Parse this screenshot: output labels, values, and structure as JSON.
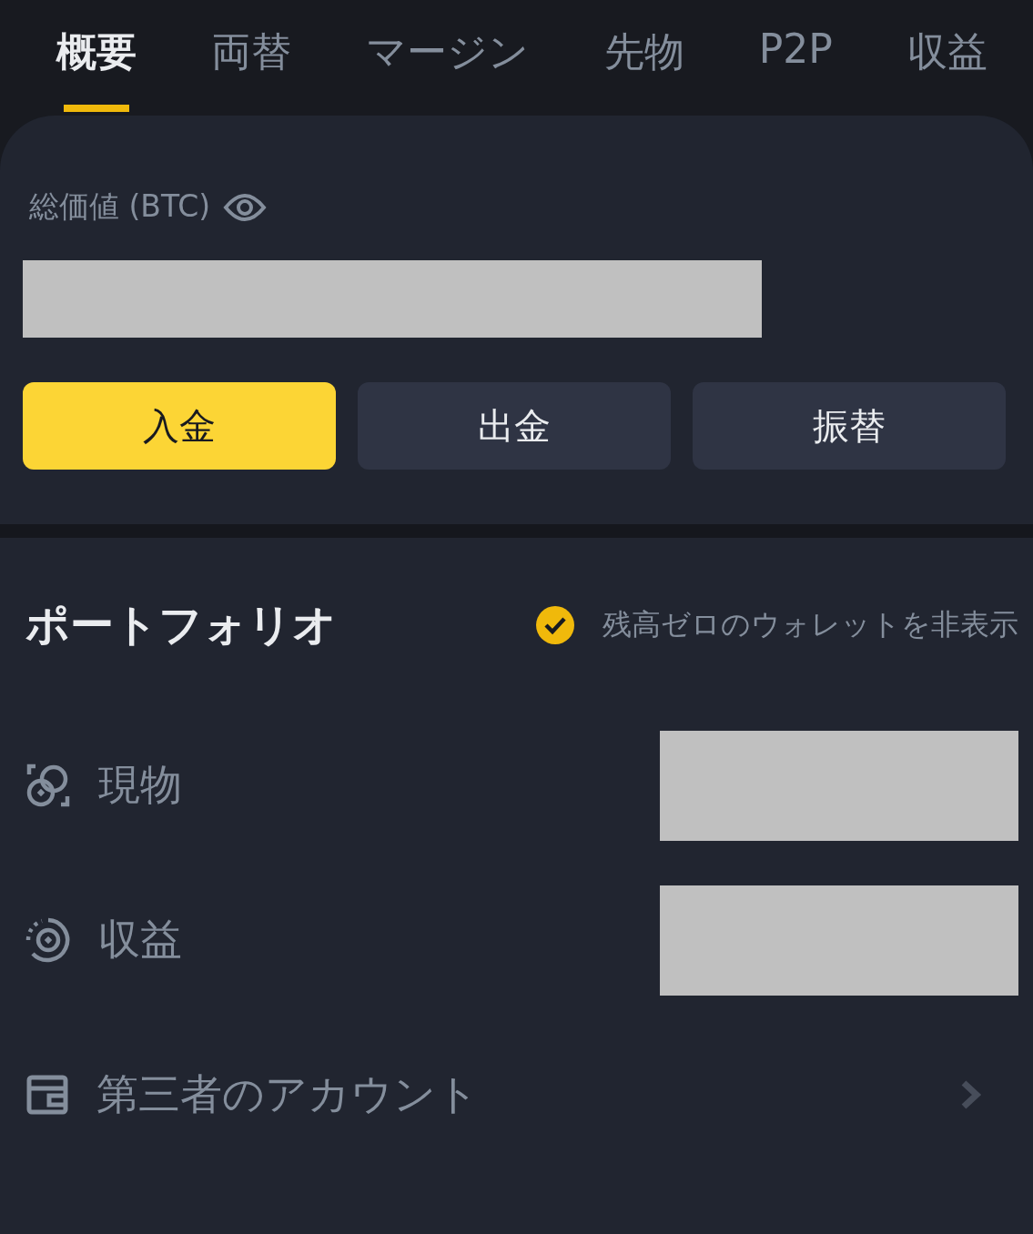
{
  "tabs": [
    {
      "label": "概要",
      "selected": true
    },
    {
      "label": "両替",
      "selected": false
    },
    {
      "label": "マージン",
      "selected": false
    },
    {
      "label": "先物",
      "selected": false
    },
    {
      "label": "P2P",
      "selected": false
    },
    {
      "label": "収益",
      "selected": false
    }
  ],
  "balance": {
    "label": "総価値 (BTC)",
    "redacted": true
  },
  "actions": [
    {
      "label": "入金",
      "kind": "primary"
    },
    {
      "label": "出金",
      "kind": "secondary"
    },
    {
      "label": "振替",
      "kind": "secondary"
    }
  ],
  "portfolio": {
    "title": "ポートフォリオ",
    "hide_zero": {
      "label": "残高ゼロのウォレットを非表示",
      "checked": true
    },
    "rows": [
      {
        "kind": "spot",
        "label": "現物",
        "redacted": true
      },
      {
        "kind": "earn",
        "label": "収益",
        "redacted": true
      },
      {
        "kind": "wallet",
        "label": "第三者のアカウント",
        "redacted": false
      }
    ]
  }
}
